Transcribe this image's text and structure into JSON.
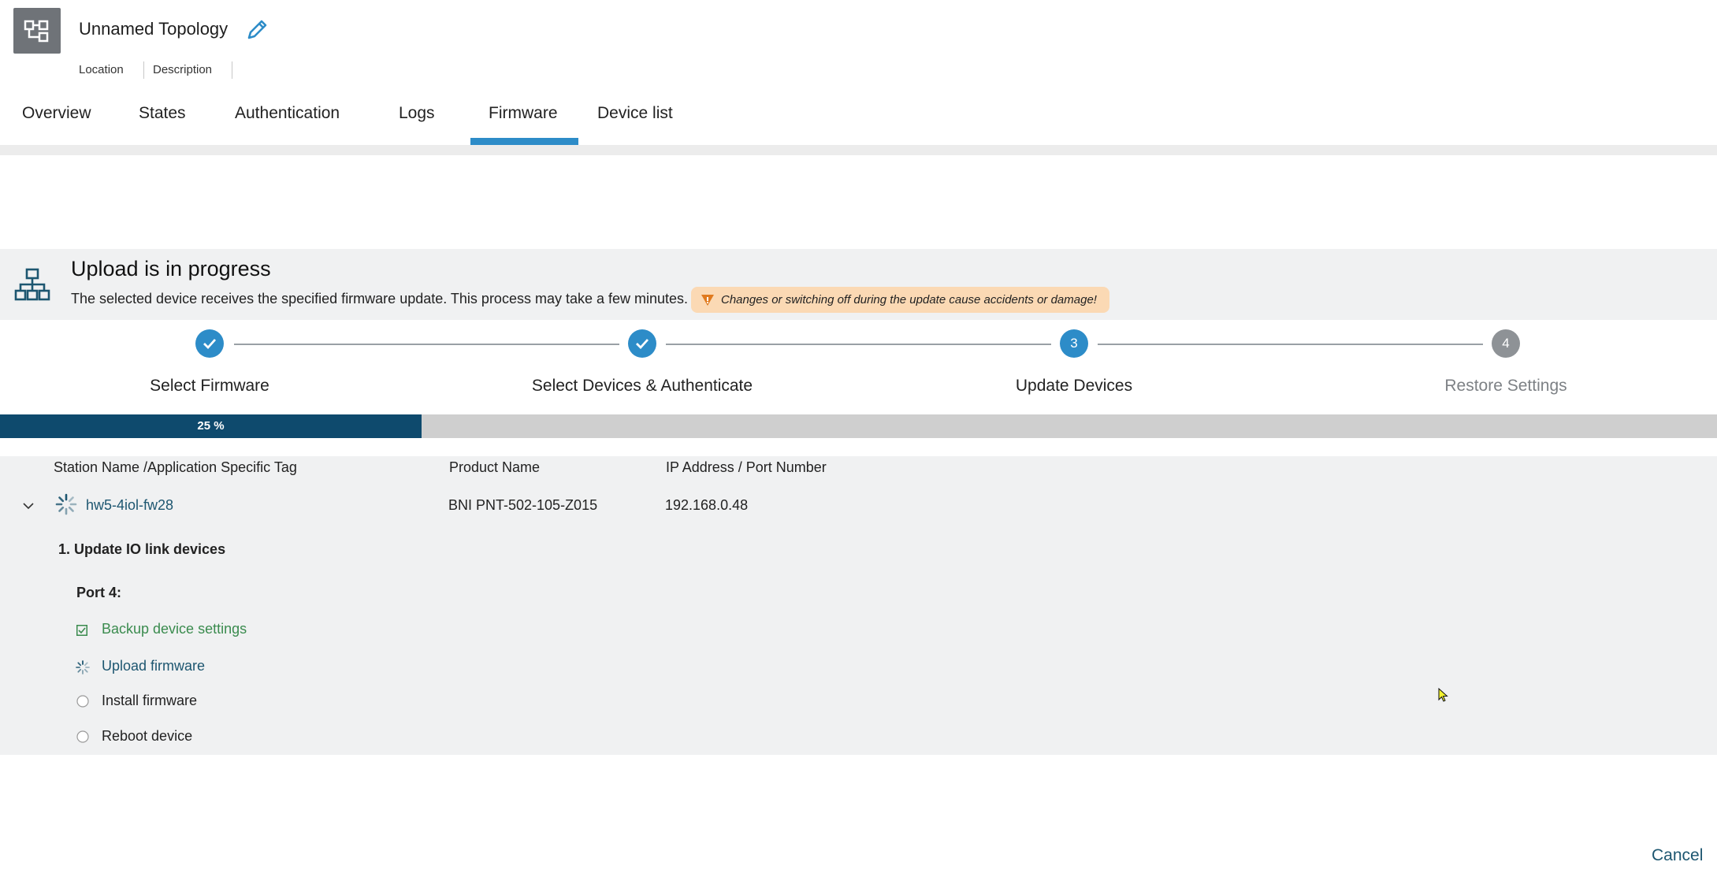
{
  "header": {
    "title": "Unnamed Topology",
    "location_label": "Location",
    "description_label": "Description"
  },
  "tabs": [
    {
      "label": "Overview"
    },
    {
      "label": "States"
    },
    {
      "label": "Authentication"
    },
    {
      "label": "Logs"
    },
    {
      "label": "Firmware",
      "active": true
    },
    {
      "label": "Device list"
    }
  ],
  "banner": {
    "title": "Upload is in progress",
    "description": "The selected device receives the specified firmware update. This process may take a few minutes.",
    "warning": "Changes or switching off during the update cause accidents or damage!"
  },
  "stepper": {
    "steps": [
      {
        "label": "Select Firmware",
        "state": "done"
      },
      {
        "label": "Select Devices & Authenticate",
        "state": "done"
      },
      {
        "label": "Update Devices",
        "state": "active",
        "number": "3"
      },
      {
        "label": "Restore Settings",
        "state": "pending",
        "number": "4"
      }
    ]
  },
  "progress": {
    "value": 0.25,
    "label": "25 %"
  },
  "table": {
    "columns": [
      "Station Name /Application Specific Tag",
      "Product Name",
      "IP Address / Port Number"
    ],
    "row": {
      "station": "hw5-4iol-fw28",
      "product": "BNI PNT-502-105-Z015",
      "ip": "192.168.0.48"
    },
    "task_title": "1. Update IO link devices",
    "port_label": "Port 4:",
    "tasks": [
      {
        "label": "Backup device settings",
        "status": "done"
      },
      {
        "label": "Upload firmware",
        "status": "in-progress"
      },
      {
        "label": "Install firmware",
        "status": "pending"
      },
      {
        "label": "Reboot device",
        "status": "pending"
      }
    ]
  },
  "footer": {
    "cancel_label": "Cancel"
  },
  "colors": {
    "accent": "#2d8cc8",
    "progress": "#0e4a6d",
    "success": "#3a8b4e",
    "link": "#1d5670",
    "warning_bg": "#fbd9b4"
  },
  "icons": [
    "topology-icon",
    "edit-pencil-icon",
    "network-icon",
    "warning-icon",
    "check-icon",
    "chevron-down-icon",
    "spinner-icon",
    "checkbox-checked-icon",
    "radio-empty-icon",
    "mouse-cursor-icon"
  ]
}
